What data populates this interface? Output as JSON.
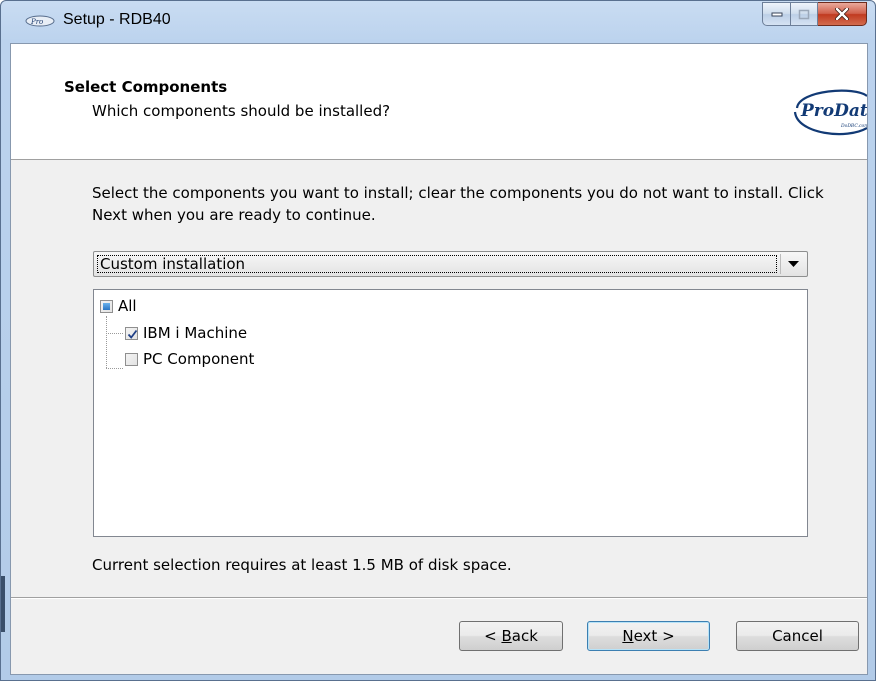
{
  "window": {
    "title": "Setup - RDB40",
    "icon": "prodata-app-icon",
    "controls": [
      "minimize-icon",
      "maximize-icon",
      "close-icon"
    ]
  },
  "header": {
    "title": "Select Components",
    "subtitle": "Which components should be installed?",
    "logo": {
      "text": "ProData",
      "subtext": "DoDBC.com"
    }
  },
  "instructions": "Select the components you want to install; clear the components you do not want to install. Click Next when you are ready to continue.",
  "install_type": {
    "selected": "Custom installation"
  },
  "components": [
    {
      "label": "All",
      "state": "partial",
      "level": 0
    },
    {
      "label": "IBM i Machine",
      "state": "checked",
      "level": 1
    },
    {
      "label": "PC Component",
      "state": "unchecked",
      "level": 1
    }
  ],
  "disk_space": "Current selection requires at least 1.5 MB of disk space.",
  "buttons": {
    "back": {
      "prefix": "< ",
      "mnemonic": "B",
      "rest": "ack"
    },
    "next": {
      "mnemonic": "N",
      "rest": "ext >"
    },
    "cancel": "Cancel"
  },
  "colors": {
    "client_bg": "#f0f0f0",
    "close_button": "#c75050",
    "checkbox_partial": "#2a76c4"
  }
}
